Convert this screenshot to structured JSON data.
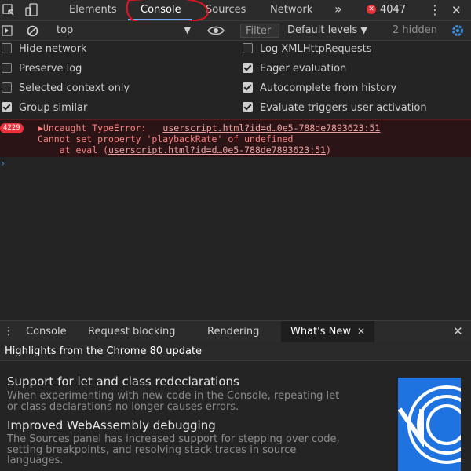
{
  "tabs": {
    "elements": "Elements",
    "console": "Console",
    "sources": "Sources",
    "network": "Network",
    "more": "»",
    "error_count": "4047"
  },
  "toolbar": {
    "context": "top",
    "filter_placeholder": "Filter",
    "levels": "Default levels",
    "hidden": "2 hidden"
  },
  "settings": {
    "left": [
      {
        "label": "Hide network",
        "checked": false
      },
      {
        "label": "Preserve log",
        "checked": false
      },
      {
        "label": "Selected context only",
        "checked": false
      },
      {
        "label": "Group similar",
        "checked": true
      }
    ],
    "right": [
      {
        "label": "Log XMLHttpRequests",
        "checked": false
      },
      {
        "label": "Eager evaluation",
        "checked": true
      },
      {
        "label": "Autocomplete from history",
        "checked": true
      },
      {
        "label": "Evaluate triggers user activation",
        "checked": true
      }
    ]
  },
  "error": {
    "count": "4229",
    "line1_prefix": "▶Uncaught TypeError: ",
    "line1_link": "userscript.html?id=d…0e5-788de7893623:51",
    "line2": "Cannot set property 'playbackRate' of undefined",
    "line3_prefix": "    at eval (",
    "line3_link": "userscript.html?id=d…0e5-788de7893623:51",
    "line3_suffix": ")"
  },
  "drawer": {
    "tabs": [
      "Console",
      "Request blocking",
      "Rendering",
      "What's New"
    ],
    "highlights": "Highlights from the Chrome 80 update",
    "items": [
      {
        "title": "Support for let and class redeclarations",
        "desc": "When experimenting with new code in the Console, repeating let or class declarations no longer causes errors."
      },
      {
        "title": "Improved WebAssembly debugging",
        "desc": "The Sources panel has increased support for stepping over code, setting breakpoints, and resolving stack traces in source languages."
      }
    ]
  },
  "colors": {
    "accent": "#7aa7f5",
    "error_red": "#e8323c",
    "annotation_red": "#e0141e",
    "whatsnew_blue": "#1f73e0"
  }
}
